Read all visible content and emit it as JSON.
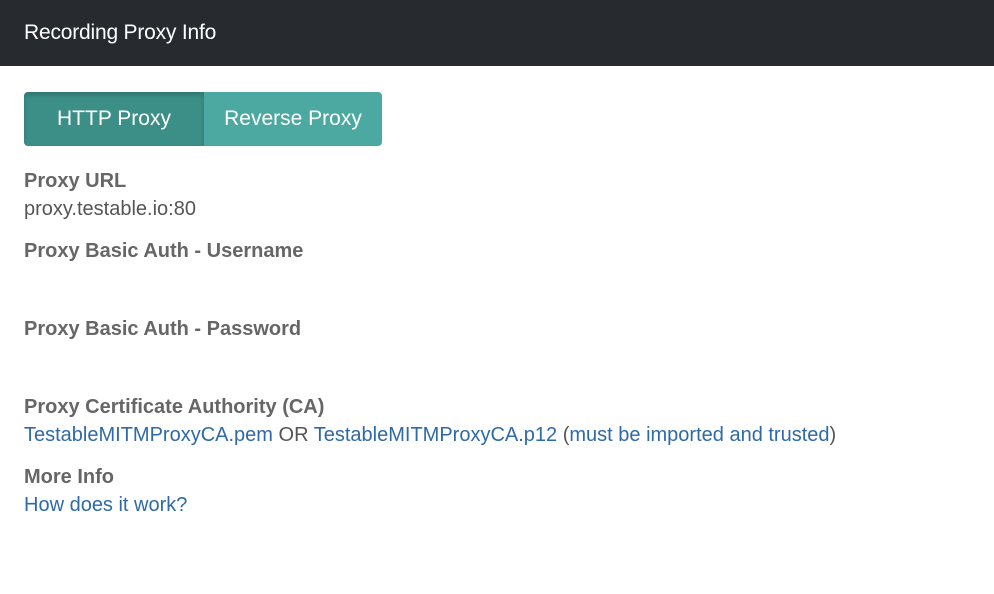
{
  "header": {
    "title": "Recording Proxy Info"
  },
  "tabs": {
    "http_proxy": "HTTP Proxy",
    "reverse_proxy": "Reverse Proxy"
  },
  "proxy_url": {
    "label": "Proxy URL",
    "value": "proxy.testable.io:80"
  },
  "auth_username": {
    "label": "Proxy Basic Auth - Username",
    "value": ""
  },
  "auth_password": {
    "label": "Proxy Basic Auth - Password",
    "value": ""
  },
  "ca": {
    "label": "Proxy Certificate Authority (CA)",
    "pem_link": "TestableMITMProxyCA.pem",
    "or_text": " OR ",
    "p12_link": "TestableMITMProxyCA.p12",
    "note_open": " (",
    "note_link": "must be imported and trusted",
    "note_close": ")"
  },
  "more_info": {
    "label": "More Info",
    "link": "How does it work?"
  },
  "colors": {
    "header_bg": "#272b30",
    "tab_active": "#3b8f87",
    "tab_inactive": "#4ba9a2",
    "link": "#2e6aa7"
  }
}
